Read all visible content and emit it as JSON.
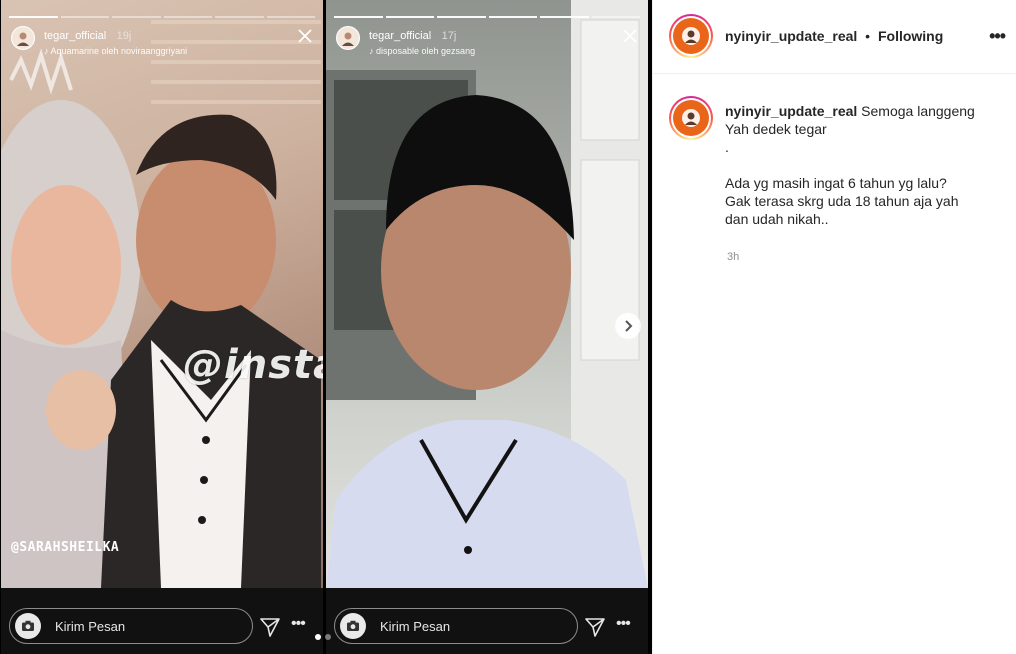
{
  "stories": [
    {
      "user": "tegar_official",
      "time": "19j",
      "music": "♪ Aquamarine oleh noviraanggriyani",
      "watermark": "@insta.nyinyir",
      "credit": "@SARAHSHEILKA",
      "message_placeholder": "Kirim Pesan",
      "progress_total": 6,
      "progress_done": 1
    },
    {
      "user": "tegar_official",
      "time": "17j",
      "music": "♪ disposable oleh gezsang",
      "message_placeholder": "Kirim Pesan",
      "progress_total": 6,
      "progress_done": 5
    }
  ],
  "carousel": {
    "total": 2,
    "active": 1
  },
  "post": {
    "username": "nyinyir_update_real",
    "separator": "•",
    "follow_status": "Following",
    "caption_lines": [
      "Semoga langgeng",
      "Yah dedek tegar",
      ".",
      "",
      "Ada yg masih ingat 6 tahun yg lalu?",
      "Gak terasa skrg uda 18 tahun aja yah",
      "dan udah nikah.."
    ],
    "time": "3h"
  },
  "colors": {
    "avatar_bg": "#e8651a",
    "text": "#262626",
    "muted": "#8e8e8e"
  }
}
